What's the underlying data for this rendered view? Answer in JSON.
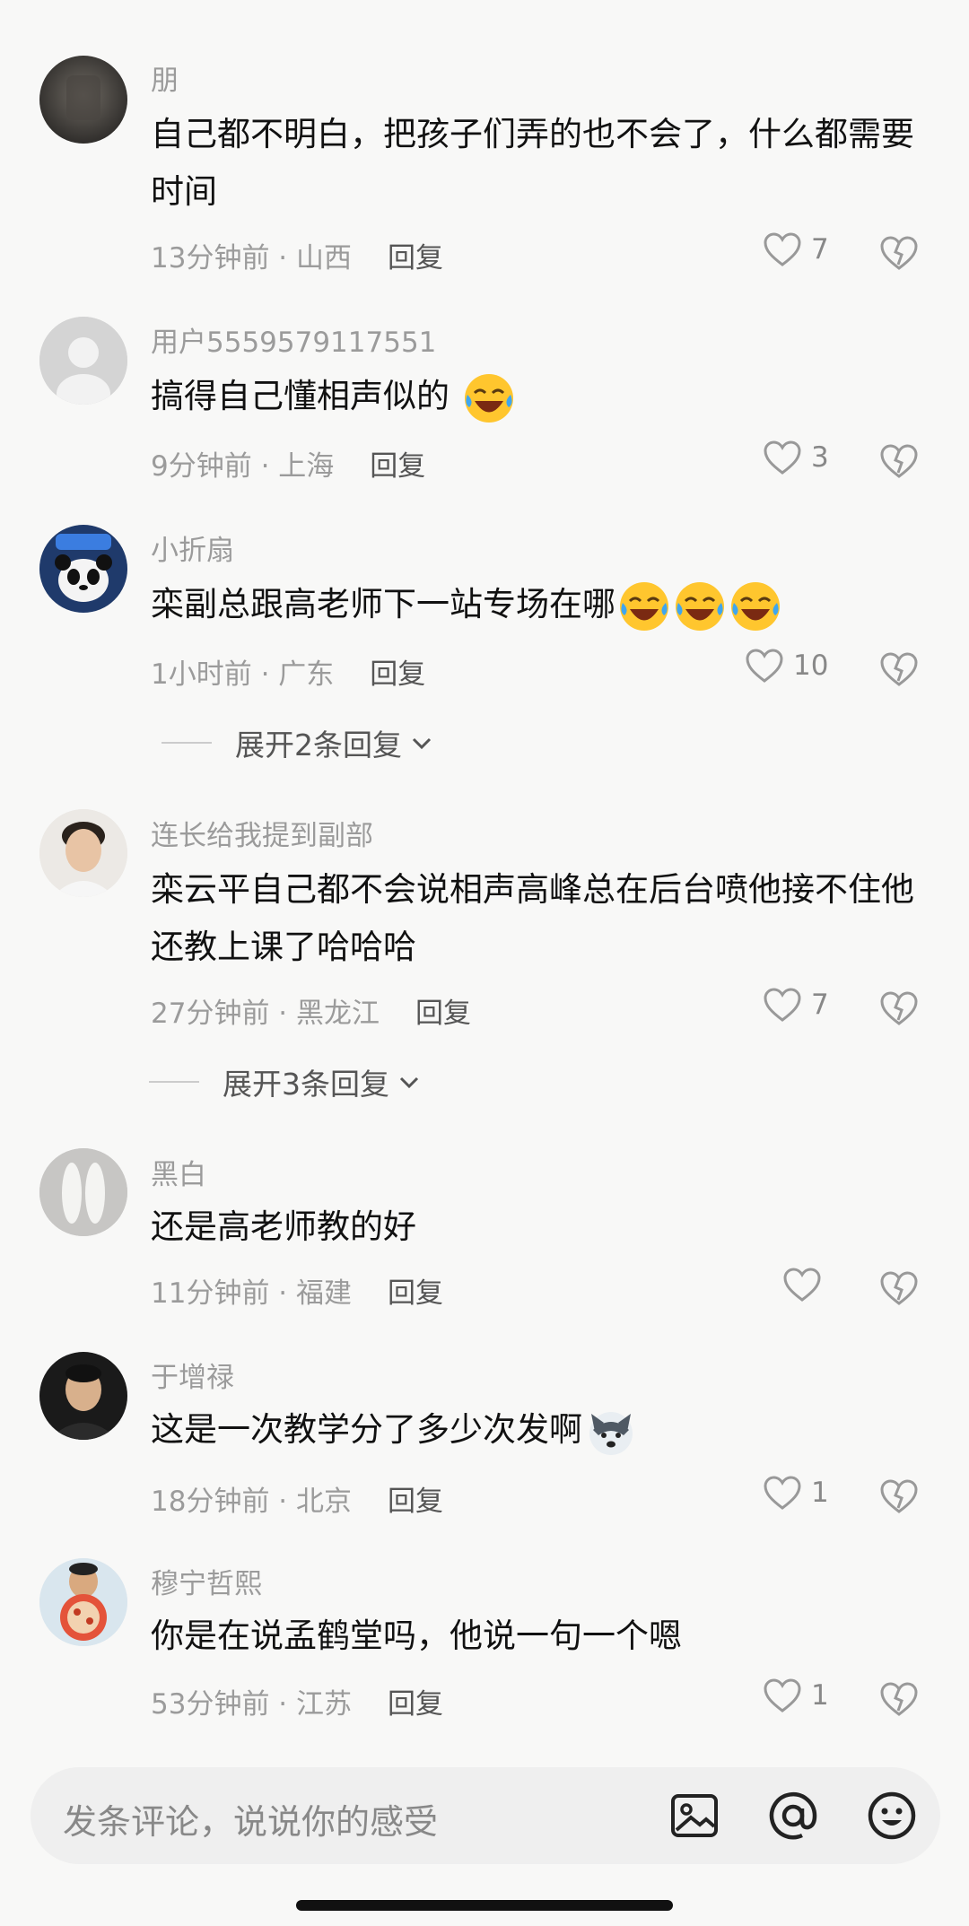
{
  "comments": [
    {
      "user": "朋",
      "text": "自己都不明白，把孩子们弄的也不会了，什么都需要时间",
      "emoji_count": 0,
      "time": "13分钟前",
      "location": "山西",
      "likes": "7",
      "avatar_icon": "dark-blurred-avatar"
    },
    {
      "user": "用户5559579117551",
      "text": "搞得自己懂相声似的",
      "emoji_count": 1,
      "time": "9分钟前",
      "location": "上海",
      "likes": "3",
      "avatar_icon": "default-user-avatar"
    },
    {
      "user": "小折扇",
      "text": "栾副总跟高老师下一站专场在哪",
      "emoji_count": 3,
      "time": "1小时前",
      "location": "广东",
      "likes": "10",
      "avatar_icon": "panda-avatar"
    },
    {
      "user": "连长给我提到副部",
      "text": "栾云平自己都不会说相声高峰总在后台喷他接不住他还教上课了哈哈哈",
      "emoji_count": 0,
      "time": "27分钟前",
      "location": "黑龙江",
      "likes": "7",
      "avatar_icon": "man-avatar"
    },
    {
      "user": "黑白",
      "text": "还是高老师教的好",
      "emoji_count": 0,
      "time": "11分钟前",
      "location": "福建",
      "likes": "",
      "avatar_icon": "sneakers-avatar"
    },
    {
      "user": "于增禄",
      "text": "这是一次教学分了多少次发啊",
      "emoji_count": 1,
      "time": "18分钟前",
      "location": "北京",
      "likes": "1",
      "avatar_icon": "man-dark-avatar"
    },
    {
      "user": "穆宁哲熙",
      "text": "你是在说孟鹤堂吗，他说一句一个嗯",
      "emoji_count": 0,
      "time": "53分钟前",
      "location": "江苏",
      "likes": "1",
      "avatar_icon": "man-holding-pizza-avatar"
    }
  ],
  "meta_separator": " · ",
  "reply_label": "回复",
  "expand_replies": [
    {
      "label": "展开2条回复"
    },
    {
      "label": "展开3条回复"
    }
  ],
  "input_bar": {
    "placeholder": "发条评论，说说你的感受",
    "icons": [
      "image-icon",
      "at-icon",
      "emoji-icon"
    ]
  },
  "colors": {
    "background": "#f8f8f7",
    "secondary_text": "#9b9b9b",
    "primary_text": "#111111"
  }
}
